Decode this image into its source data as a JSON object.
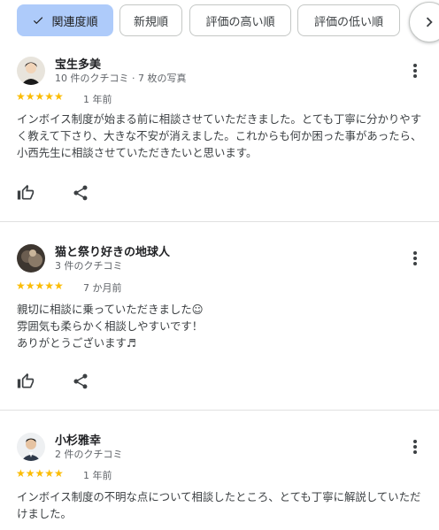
{
  "sort_chips": [
    {
      "label": "関連度順",
      "active": true,
      "icon": "check-icon"
    },
    {
      "label": "新規順",
      "active": false
    },
    {
      "label": "評価の高い順",
      "active": false
    },
    {
      "label": "評価の低い順",
      "active": false
    }
  ],
  "next_icon": "chevron-right-icon",
  "reviews": [
    {
      "author": "宝生多美",
      "meta": "10 件のクチコミ · 7 枚の写真",
      "stars": "★★★★★",
      "rating": 5,
      "age": "1 年前",
      "text": "インボイス制度が始まる前に相談させていただきました。とても丁寧に分かりやすく教えて下さり、大きな不安が消えました。これからも何か困った事があったら、小西先生に相談させていただきたいと思います。",
      "like_icon": "thumbs-up-icon",
      "share_icon": "share-icon"
    },
    {
      "author": "猫と祭り好きの地球人",
      "meta": "3 件のクチコミ",
      "stars": "★★★★★",
      "rating": 5,
      "age": "7 か月前",
      "text": "親切に相談に乗っていただきました☺\n雰囲気も柔らかく相談しやすいです！\nありがとうございます♬",
      "like_icon": "thumbs-up-icon",
      "share_icon": "share-icon"
    },
    {
      "author": "小杉雅幸",
      "meta": "2 件のクチコミ",
      "stars": "★★★★★",
      "rating": 5,
      "age": "1 年前",
      "text": "インボイス制度の不明な点について相談したところ、とても丁寧に解説していただけました。"
    }
  ],
  "colors": {
    "star": "#fbbc04",
    "active_chip": "#aecbfa",
    "divider": "#e0e0e0"
  }
}
